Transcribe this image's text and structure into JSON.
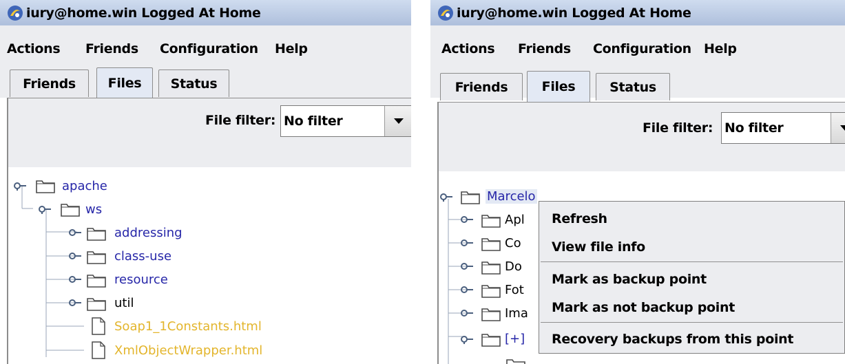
{
  "windows": [
    {
      "title": "iury@home.win Logged At Home",
      "menu": [
        "Actions",
        "Friends",
        "Configuration",
        "Help"
      ],
      "tabs": [
        "Friends",
        "Files",
        "Status"
      ],
      "selected_tab": "Files",
      "filter": {
        "label": "File filter:",
        "value": "No filter"
      },
      "tree": [
        "apache",
        "ws",
        "addressing",
        "class-use",
        "resource",
        "util",
        "Soap1_1Constants.html",
        "XmlObjectWrapper.html"
      ]
    },
    {
      "title": "iury@home.win Logged At Home",
      "menu": [
        "Actions",
        "Friends",
        "Configuration",
        "Help"
      ],
      "tabs": [
        "Friends",
        "Files",
        "Status"
      ],
      "selected_tab": "Files",
      "filter": {
        "label": "File filter:",
        "value": "No filter"
      },
      "tree": [
        "Marcelo",
        "Apl",
        "Co",
        "Do",
        "Fot",
        "Ima",
        "[+]"
      ],
      "context_menu": [
        "Refresh",
        "View file info",
        "Mark as backup point",
        "Mark as not backup point",
        "Recovery backups from this point"
      ]
    }
  ],
  "icons": {
    "app": "java-duke-icon",
    "folder": "folder-icon",
    "file": "file-icon",
    "expand": "tree-handle-icon",
    "dropdown": "dropdown-arrow-icon"
  },
  "colors": {
    "titlebar": "#aebfdc",
    "folder_text": "#2626a8",
    "unloaded_text": "#000000",
    "file_text": "#e3b52c",
    "tab_selected": "#e3e9f4",
    "panel_bg": "#ecedf0"
  }
}
